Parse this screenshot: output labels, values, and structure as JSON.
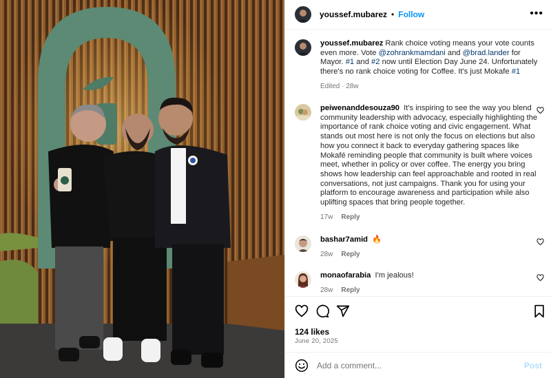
{
  "post": {
    "username": "youssef.mubarez",
    "follow_label": "Follow",
    "separator": "•",
    "more_icon": "more-horizontal-icon",
    "caption": {
      "username": "youssef.mubarez",
      "t1": "Rank choice voting means your vote counts even more. Vote ",
      "m1": "@zohrankmamdani",
      "t2": " and ",
      "m2": "@brad.lander",
      "t3": " for Mayor. ",
      "h1": "#1",
      "t4": " and ",
      "h2": "#2",
      "t5": " now until Election Day June 24. Unfortunately there's no rank choice voting for Coffee. It's just Mokafe ",
      "h3": "#1",
      "meta": "Edited · 28w"
    },
    "comments": [
      {
        "username": "peiwenanddesouza90",
        "text": "It's inspiring to see the way you blend community leadership with advocacy, especially highlighting the importance of rank choice voting and civic engagement. What stands out most here is not only the focus on elections but also how you connect it back to everyday gathering spaces like Mokafé reminding people that community is built where voices meet, whether in policy or over coffee. The energy you bring shows how leadership can feel approachable and rooted in real conversations, not just campaigns. Thank you for using your platform to encourage awareness and participation while also uplifting spaces that bring people together.",
        "time": "17w",
        "reply": "Reply"
      },
      {
        "username": "bashar7amid",
        "text": "🔥",
        "time": "28w",
        "reply": "Reply"
      },
      {
        "username": "monaofarabia",
        "text": "I'm jealous!",
        "time": "28w",
        "reply": "Reply"
      }
    ],
    "likes": "124 likes",
    "date": "June 20, 2025",
    "add_comment_placeholder": "Add a comment...",
    "post_label": "Post"
  },
  "colors": {
    "accent": "#0095f6",
    "link": "#00376b",
    "muted": "#737373",
    "post_disabled": "#b2dffc"
  }
}
